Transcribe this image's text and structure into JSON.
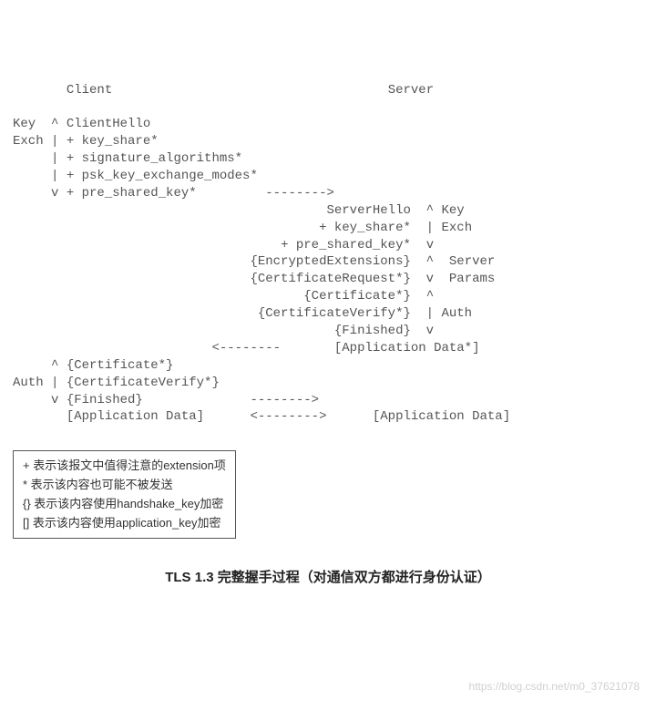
{
  "header": {
    "client": "Client",
    "server": "Server"
  },
  "client_block": {
    "label1": "Key",
    "label2": "Exch",
    "l1": "^ ClientHello",
    "l2": "| + key_share*",
    "l3": "| + signature_algorithms*",
    "l4": "| + psk_key_exchange_modes*",
    "l5": "v + pre_shared_key*         -------->"
  },
  "server_block": {
    "l1": "ServerHello  ^ Key",
    "l2": "+ key_share*  | Exch",
    "l3": "+ pre_shared_key*  v",
    "l4": "{EncryptedExtensions}  ^  Server",
    "l5": "{CertificateRequest*}  v  Params",
    "l6": "{Certificate*}  ^",
    "l7": "{CertificateVerify*}  | Auth",
    "l8": "{Finished}  v",
    "l9": "<--------       [Application Data*]"
  },
  "client_auth": {
    "label": "Auth",
    "l1": "^ {Certificate*}",
    "l2": "| {CertificateVerify*}",
    "l3": "v {Finished}              -------->",
    "l4": "  [Application Data]      <-------->      [Application Data]"
  },
  "legend": {
    "l1": "+  表示该报文中值得注意的extension项",
    "l2": "*  表示该内容也可能不被发送",
    "l3": "{}  表示该内容使用handshake_key加密",
    "l4": "[]  表示该内容使用application_key加密"
  },
  "caption": "TLS 1.3 完整握手过程（对通信双方都进行身份认证）",
  "watermark": "https://blog.csdn.net/m0_37621078"
}
